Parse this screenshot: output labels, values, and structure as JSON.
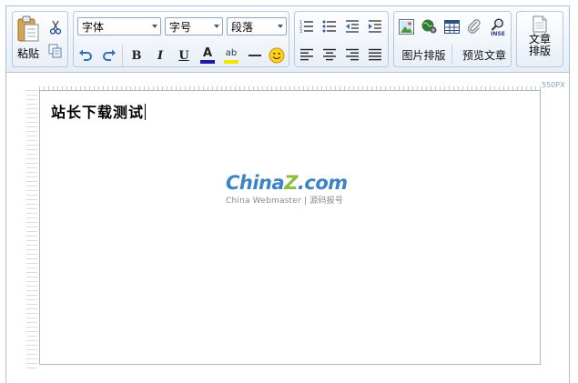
{
  "toolbar": {
    "paste_label": "粘贴",
    "font_family": {
      "value": "字体"
    },
    "font_size": {
      "value": "字号"
    },
    "paragraph": {
      "value": "段落"
    },
    "image_layout_label": "图片排版",
    "preview_label": "预览文章",
    "article_layout_label": "文章\n排版",
    "bold_label": "B",
    "italic_label": "I",
    "underline_label": "U",
    "font_color_label": "A",
    "highlight_label": "ab",
    "insert_label": "INSE"
  },
  "ruler": {
    "width_label": "550PX"
  },
  "document": {
    "text": "站长下载测试"
  },
  "watermark": {
    "brand_part1": "China",
    "brand_part2": "Z",
    "brand_part3": ".com",
    "tagline": "China Webmaster | 源码报号"
  },
  "colors": {
    "toolbar_border": "#b9c9dc",
    "accent_blue": "#3d83c7",
    "accent_green": "#8cbf3f",
    "font_color_bar": "#1a1aa6",
    "highlight_bar": "#f2e600"
  }
}
